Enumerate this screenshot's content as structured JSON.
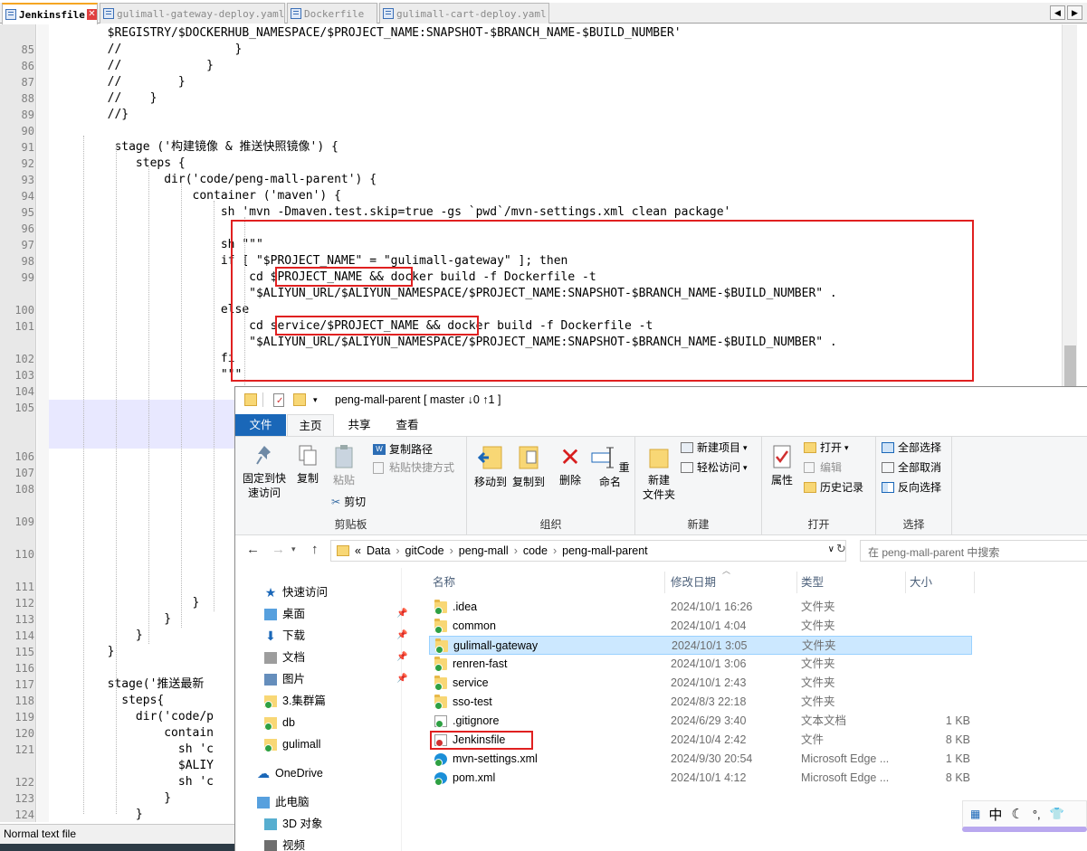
{
  "editor": {
    "tabs": [
      {
        "label": "Jenkinsfile",
        "active": true
      },
      {
        "label": "gulimall-gateway-deploy.yaml",
        "active": false
      },
      {
        "label": "Dockerfile",
        "active": false
      },
      {
        "label": "gulimall-cart-deploy.yaml",
        "active": false
      }
    ],
    "lines": [
      {
        "num": "",
        "text": "        $REGISTRY/$DOCKERHUB_NAMESPACE/$PROJECT_NAME:SNAPSHOT-$BRANCH_NAME-$BUILD_NUMBER'"
      },
      {
        "num": "85",
        "text": "        //                }"
      },
      {
        "num": "86",
        "text": "        //            }"
      },
      {
        "num": "87",
        "text": "        //        }"
      },
      {
        "num": "88",
        "text": "        //    }"
      },
      {
        "num": "89",
        "text": "        //}"
      },
      {
        "num": "90",
        "text": ""
      },
      {
        "num": "91",
        "text": "         stage ('构建镜像 & 推送快照镜像') {"
      },
      {
        "num": "92",
        "text": "            steps {"
      },
      {
        "num": "93",
        "text": "                dir('code/peng-mall-parent') {"
      },
      {
        "num": "94",
        "text": "                    container ('maven') {"
      },
      {
        "num": "95",
        "text": "                        sh 'mvn -Dmaven.test.skip=true -gs `pwd`/mvn-settings.xml clean package'"
      },
      {
        "num": "96",
        "text": ""
      },
      {
        "num": "97",
        "text": "                        sh \"\"\""
      },
      {
        "num": "98",
        "text": "                        if [ \"$PROJECT_NAME\" = \"gulimall-gateway\" ]; then"
      },
      {
        "num": "99",
        "text": "                            cd $PROJECT_NAME && docker build -f Dockerfile -t"
      },
      {
        "num": "",
        "text": "                            \"$ALIYUN_URL/$ALIYUN_NAMESPACE/$PROJECT_NAME:SNAPSHOT-$BRANCH_NAME-$BUILD_NUMBER\" ."
      },
      {
        "num": "100",
        "text": "                        else"
      },
      {
        "num": "101",
        "text": "                            cd service/$PROJECT_NAME && docker build -f Dockerfile -t"
      },
      {
        "num": "",
        "text": "                            \"$ALIYUN_URL/$ALIYUN_NAMESPACE/$PROJECT_NAME:SNAPSHOT-$BRANCH_NAME-$BUILD_NUMBER\" ."
      },
      {
        "num": "102",
        "text": "                        fi"
      },
      {
        "num": "103",
        "text": "                        \"\"\""
      },
      {
        "num": "104",
        "text": ""
      },
      {
        "num": "105",
        "text": ""
      },
      {
        "num": "106",
        "text": ""
      },
      {
        "num": "107",
        "text": ""
      },
      {
        "num": "108",
        "text": ""
      },
      {
        "num": "109",
        "text": ""
      },
      {
        "num": "110",
        "text": ""
      },
      {
        "num": "111",
        "text": ""
      },
      {
        "num": "112",
        "text": "                    }"
      },
      {
        "num": "113",
        "text": "                }"
      },
      {
        "num": "114",
        "text": "            }"
      },
      {
        "num": "115",
        "text": "        }"
      },
      {
        "num": "116",
        "text": ""
      },
      {
        "num": "117",
        "text": "        stage('推送最新"
      },
      {
        "num": "118",
        "text": "          steps{"
      },
      {
        "num": "119",
        "text": "            dir('code/p"
      },
      {
        "num": "120",
        "text": "                contain"
      },
      {
        "num": "121",
        "text": "                  sh 'c"
      },
      {
        "num": "",
        "text": "                  $ALIY"
      },
      {
        "num": "122",
        "text": "                  sh 'c"
      },
      {
        "num": "123",
        "text": "                }"
      },
      {
        "num": "124",
        "text": "            }"
      }
    ],
    "status": "Normal text file"
  },
  "explorer": {
    "title": "peng-mall-parent [ master ↓0 ↑1 ]",
    "ribbon_tabs": [
      "文件",
      "主页",
      "共享",
      "查看"
    ],
    "groups": {
      "clipboard": {
        "label": "剪贴板",
        "pin": "固定到快\n速访问",
        "copy": "复制",
        "paste": "粘贴",
        "copy_path": "复制路径",
        "paste_shortcut": "粘贴快捷方式",
        "cut": "剪切"
      },
      "organize": {
        "label": "组织",
        "move_to": "移动到",
        "copy_to": "复制到",
        "delete": "删除",
        "rename": "重命名"
      },
      "new": {
        "label": "新建",
        "new_folder": "新建\n文件夹",
        "new_item": "新建项目",
        "easy_access": "轻松访问"
      },
      "open": {
        "label": "打开",
        "properties": "属性",
        "open": "打开",
        "edit": "编辑",
        "history": "历史记录"
      },
      "select": {
        "label": "选择",
        "select_all": "全部选择",
        "select_none": "全部取消",
        "invert": "反向选择"
      }
    },
    "address": {
      "prefix": "«",
      "crumbs": [
        "Data",
        "gitCode",
        "peng-mall",
        "code",
        "peng-mall-parent"
      ]
    },
    "search_placeholder": "在 peng-mall-parent 中搜索",
    "columns": [
      "名称",
      "修改日期",
      "类型",
      "大小"
    ],
    "nav": [
      {
        "label": "快速访问",
        "icon": "star-icon",
        "pinned": false
      },
      {
        "label": "桌面",
        "icon": "desktop-icon",
        "pinned": true
      },
      {
        "label": "下载",
        "icon": "download-icon",
        "pinned": true
      },
      {
        "label": "文档",
        "icon": "document-icon",
        "pinned": true
      },
      {
        "label": "图片",
        "icon": "picture-icon",
        "pinned": true
      },
      {
        "label": "3.集群篇",
        "icon": "folder-icon",
        "pinned": false
      },
      {
        "label": "db",
        "icon": "folder-icon",
        "pinned": false
      },
      {
        "label": "gulimall",
        "icon": "folder-icon",
        "pinned": false
      },
      {
        "label": "OneDrive",
        "icon": "cloud-icon",
        "pinned": false
      },
      {
        "label": "此电脑",
        "icon": "computer-icon",
        "pinned": false
      },
      {
        "label": "3D 对象",
        "icon": "cube-icon",
        "pinned": false
      },
      {
        "label": "视频",
        "icon": "video-icon",
        "pinned": false
      }
    ],
    "files": [
      {
        "name": ".idea",
        "date": "2024/10/1 16:26",
        "type": "文件夹",
        "size": "",
        "icon": "folder"
      },
      {
        "name": "common",
        "date": "2024/10/1 4:04",
        "type": "文件夹",
        "size": "",
        "icon": "folder"
      },
      {
        "name": "gulimall-gateway",
        "date": "2024/10/1 3:05",
        "type": "文件夹",
        "size": "",
        "icon": "folder",
        "selected": true
      },
      {
        "name": "renren-fast",
        "date": "2024/10/1 3:06",
        "type": "文件夹",
        "size": "",
        "icon": "folder"
      },
      {
        "name": "service",
        "date": "2024/10/1 2:43",
        "type": "文件夹",
        "size": "",
        "icon": "folder"
      },
      {
        "name": "sso-test",
        "date": "2024/8/3 22:18",
        "type": "文件夹",
        "size": "",
        "icon": "folder"
      },
      {
        "name": ".gitignore",
        "date": "2024/6/29 3:40",
        "type": "文本文档",
        "size": "1 KB",
        "icon": "doc"
      },
      {
        "name": "Jenkinsfile",
        "date": "2024/10/4 2:42",
        "type": "文件",
        "size": "8 KB",
        "icon": "doc-red"
      },
      {
        "name": "mvn-settings.xml",
        "date": "2024/9/30 20:54",
        "type": "Microsoft Edge ...",
        "size": "1 KB",
        "icon": "edge"
      },
      {
        "name": "pom.xml",
        "date": "2024/10/1 4:12",
        "type": "Microsoft Edge ...",
        "size": "8 KB",
        "icon": "edge"
      }
    ]
  },
  "ime": {
    "label": "中"
  },
  "colors": {
    "accent": "#1a67b8",
    "highlight_box": "#e02020",
    "selected_row": "#cce8ff"
  }
}
